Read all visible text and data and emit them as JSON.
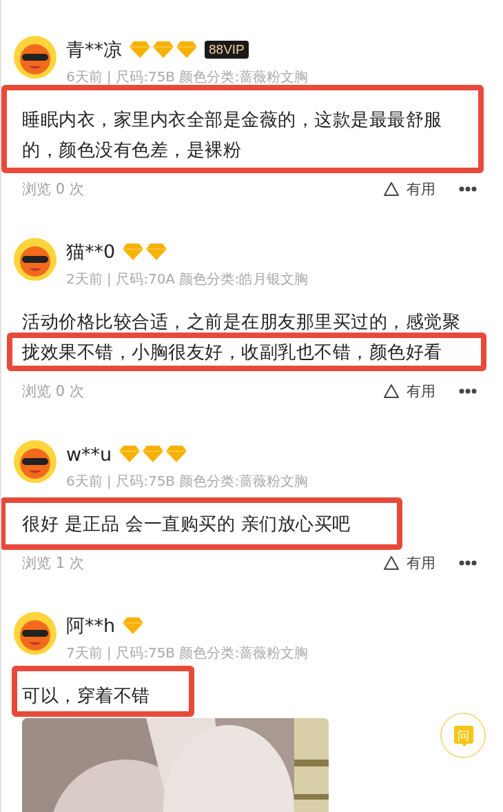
{
  "reviews": [
    {
      "user": "青**凉",
      "badges": [
        {
          "kind": "diamond"
        },
        {
          "kind": "diamond"
        },
        {
          "kind": "diamond"
        }
      ],
      "vip_badge": "88VIP",
      "meta": "6天前 | 尺码:75B 颜色分类:蔷薇粉文胸",
      "text": "睡眠内衣，家里内衣全部是金薇的，这款是最最舒服的，颜色没有色差，是裸粉",
      "highlighted": true,
      "views": "浏览 0 次",
      "useful": "有用"
    },
    {
      "user": "猫**0",
      "badges": [
        {
          "kind": "diamond"
        },
        {
          "kind": "diamond"
        }
      ],
      "meta": "2天前 | 尺码:70A 颜色分类:皓月银文胸",
      "text": "活动价格比较合适，之前是在朋友那里买过的，感觉聚拢效果不错，小胸很友好，收副乳也不错，颜色好看",
      "highlighted": true,
      "views": "浏览 0 次",
      "useful": "有用"
    },
    {
      "user": "w**u",
      "badges": [
        {
          "kind": "diamond"
        },
        {
          "kind": "diamond"
        },
        {
          "kind": "diamond"
        }
      ],
      "meta": "6天前 | 尺码:75B 颜色分类:蔷薇粉文胸",
      "text": "很好 是正品 会一直购买的 亲们放心买吧",
      "highlighted": true,
      "views": "浏览 1 次",
      "useful": "有用"
    },
    {
      "user": "阿**h",
      "badges": [
        {
          "kind": "diamond"
        }
      ],
      "meta": "7天前 | 尺码:75B 颜色分类:蔷薇粉文胸",
      "text": "可以，穿着不错",
      "highlighted": true,
      "photos": [
        {
          "kind": "picture"
        }
      ]
    }
  ],
  "ask_button": {
    "label": "问"
  }
}
